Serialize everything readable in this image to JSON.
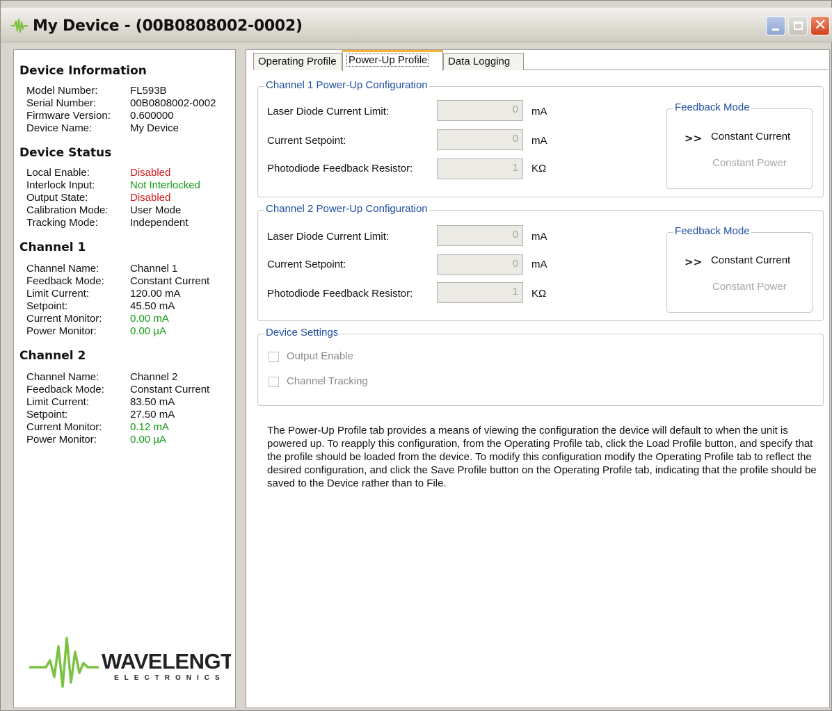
{
  "window": {
    "title": "My Device - (00B0808002-0002)"
  },
  "device_info": {
    "heading": "Device Information",
    "rows": [
      {
        "label": "Model Number:",
        "value": "FL593B"
      },
      {
        "label": "Serial Number:",
        "value": "00B0808002-0002"
      },
      {
        "label": "Firmware Version:",
        "value": "0.600000"
      },
      {
        "label": "Device Name:",
        "value": "My Device"
      }
    ]
  },
  "device_status": {
    "heading": "Device Status",
    "rows": [
      {
        "label": "Local Enable:",
        "value": "Disabled",
        "color": "#d21a1a"
      },
      {
        "label": "Interlock Input:",
        "value": "Not Interlocked",
        "color": "#119a11"
      },
      {
        "label": "Output State:",
        "value": "Disabled",
        "color": "#d21a1a"
      },
      {
        "label": "Calibration Mode:",
        "value": "User Mode"
      },
      {
        "label": "Tracking Mode:",
        "value": "Independent"
      }
    ]
  },
  "channel1": {
    "heading": "Channel 1",
    "rows": [
      {
        "label": "Channel Name:",
        "value": "Channel 1"
      },
      {
        "label": "Feedback Mode:",
        "value": "Constant Current"
      },
      {
        "label": "Limit Current:",
        "value": "120.00 mA"
      },
      {
        "label": "Setpoint:",
        "value": "45.50 mA"
      },
      {
        "label": "Current Monitor:",
        "value": "0.00 mA",
        "color": "#119a11"
      },
      {
        "label": "Power Monitor:",
        "value": "0.00 µA",
        "color": "#119a11"
      }
    ]
  },
  "channel2": {
    "heading": "Channel 2",
    "rows": [
      {
        "label": "Channel Name:",
        "value": "Channel 2"
      },
      {
        "label": "Feedback Mode:",
        "value": "Constant Current"
      },
      {
        "label": "Limit Current:",
        "value": "83.50 mA"
      },
      {
        "label": "Setpoint:",
        "value": "27.50 mA"
      },
      {
        "label": "Current Monitor:",
        "value": "0.12 mA",
        "color": "#119a11"
      },
      {
        "label": "Power Monitor:",
        "value": "0.00 µA",
        "color": "#119a11"
      }
    ]
  },
  "logo": {
    "name": "WAVELENGTH",
    "sub": "ELECTRONICS"
  },
  "tabs": [
    {
      "label": "Operating Profile",
      "active": false
    },
    {
      "label": "Power-Up Profile",
      "active": true
    },
    {
      "label": "Data Logging",
      "active": false
    }
  ],
  "ch1_config": {
    "legend": "Channel 1 Power-Up Configuration",
    "ld_limit_label": "Laser Diode Current Limit:",
    "ld_limit_value": "0",
    "ld_limit_unit": "mA",
    "setpoint_label": "Current Setpoint:",
    "setpoint_value": "0",
    "setpoint_unit": "mA",
    "resistor_label": "Photodiode Feedback Resistor:",
    "resistor_value": "1",
    "resistor_unit": "KΩ",
    "feedback_legend": "Feedback Mode",
    "feedback_arrow": ">>",
    "feedback_cc": "Constant Current",
    "feedback_cp": "Constant Power"
  },
  "ch2_config": {
    "legend": "Channel 2 Power-Up Configuration",
    "ld_limit_label": "Laser Diode Current Limit:",
    "ld_limit_value": "0",
    "ld_limit_unit": "mA",
    "setpoint_label": "Current Setpoint:",
    "setpoint_value": "0",
    "setpoint_unit": "mA",
    "resistor_label": "Photodiode Feedback Resistor:",
    "resistor_value": "1",
    "resistor_unit": "KΩ",
    "feedback_legend": "Feedback Mode",
    "feedback_arrow": ">>",
    "feedback_cc": "Constant Current",
    "feedback_cp": "Constant Power"
  },
  "device_settings": {
    "legend": "Device Settings",
    "output_enable": "Output Enable",
    "channel_tracking": "Channel Tracking"
  },
  "help_text": "The Power-Up Profile tab provides a means of viewing the configuration the device will default to when the unit is powered up.  To reapply this configuration, from the Operating Profile tab, click the Load Profile button, and specify that the profile should be loaded from the device.  To modify this configuration modify the Operating Profile tab to reflect the desired configuration, and click the Save Profile button on the Operating Profile tab, indicating that the profile should be saved to the Device rather than to File."
}
